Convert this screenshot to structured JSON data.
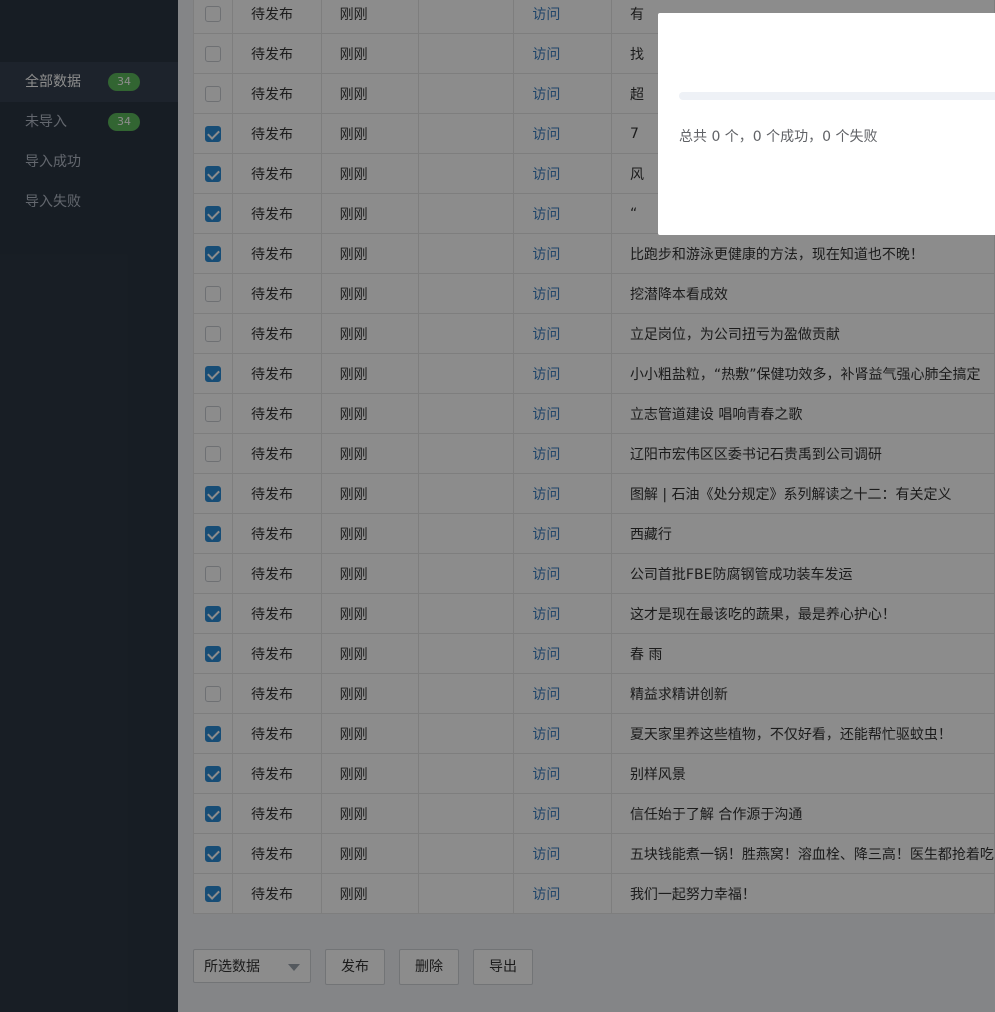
{
  "sidebar": {
    "items": [
      {
        "label": "全部数据",
        "badge": "34",
        "active": true
      },
      {
        "label": "未导入",
        "badge": "34",
        "active": false
      },
      {
        "label": "导入成功",
        "badge": "",
        "active": false
      },
      {
        "label": "导入失败",
        "badge": "",
        "active": false
      }
    ]
  },
  "table": {
    "rows": [
      {
        "checked": false,
        "status": "待发布",
        "time": "刚刚",
        "link": "访问",
        "title": "有"
      },
      {
        "checked": false,
        "status": "待发布",
        "time": "刚刚",
        "link": "访问",
        "title": "找"
      },
      {
        "checked": false,
        "status": "待发布",
        "time": "刚刚",
        "link": "访问",
        "title": "超"
      },
      {
        "checked": true,
        "status": "待发布",
        "time": "刚刚",
        "link": "访问",
        "title": "7"
      },
      {
        "checked": true,
        "status": "待发布",
        "time": "刚刚",
        "link": "访问",
        "title": "风"
      },
      {
        "checked": true,
        "status": "待发布",
        "time": "刚刚",
        "link": "访问",
        "title": "“"
      },
      {
        "checked": true,
        "status": "待发布",
        "time": "刚刚",
        "link": "访问",
        "title": "比跑步和游泳更健康的方法，现在知道也不晚！"
      },
      {
        "checked": false,
        "status": "待发布",
        "time": "刚刚",
        "link": "访问",
        "title": "挖潜降本看成效"
      },
      {
        "checked": false,
        "status": "待发布",
        "time": "刚刚",
        "link": "访问",
        "title": "立足岗位，为公司扭亏为盈做贡献"
      },
      {
        "checked": true,
        "status": "待发布",
        "time": "刚刚",
        "link": "访问",
        "title": "小小粗盐粒，“热敷”保健功效多，补肾益气强心肺全搞定"
      },
      {
        "checked": false,
        "status": "待发布",
        "time": "刚刚",
        "link": "访问",
        "title": "立志管道建设 唱响青春之歌"
      },
      {
        "checked": false,
        "status": "待发布",
        "time": "刚刚",
        "link": "访问",
        "title": "辽阳市宏伟区区委书记石贵禹到公司调研"
      },
      {
        "checked": true,
        "status": "待发布",
        "time": "刚刚",
        "link": "访问",
        "title": "图解 | 石油《处分规定》系列解读之十二：有关定义"
      },
      {
        "checked": true,
        "status": "待发布",
        "time": "刚刚",
        "link": "访问",
        "title": "西藏行"
      },
      {
        "checked": false,
        "status": "待发布",
        "time": "刚刚",
        "link": "访问",
        "title": "公司首批FBE防腐钢管成功装车发运"
      },
      {
        "checked": true,
        "status": "待发布",
        "time": "刚刚",
        "link": "访问",
        "title": "这才是现在最该吃的蔬果，最是养心护心！"
      },
      {
        "checked": true,
        "status": "待发布",
        "time": "刚刚",
        "link": "访问",
        "title": "春 雨"
      },
      {
        "checked": false,
        "status": "待发布",
        "time": "刚刚",
        "link": "访问",
        "title": "精益求精讲创新"
      },
      {
        "checked": true,
        "status": "待发布",
        "time": "刚刚",
        "link": "访问",
        "title": "夏天家里养这些植物，不仅好看，还能帮忙驱蚊虫！"
      },
      {
        "checked": true,
        "status": "待发布",
        "time": "刚刚",
        "link": "访问",
        "title": "别样风景"
      },
      {
        "checked": true,
        "status": "待发布",
        "time": "刚刚",
        "link": "访问",
        "title": "信任始于了解 合作源于沟通"
      },
      {
        "checked": true,
        "status": "待发布",
        "time": "刚刚",
        "link": "访问",
        "title": "五块钱能煮一锅！胜燕窝！溶血栓、降三高！医生都抢着吃"
      },
      {
        "checked": true,
        "status": "待发布",
        "time": "刚刚",
        "link": "访问",
        "title": "我们一起努力幸福！"
      }
    ]
  },
  "toolbar": {
    "select_value": "所选数据",
    "publish_label": "发布",
    "delete_label": "删除",
    "export_label": "导出"
  },
  "modal": {
    "summary": "总共 0 个，0 个成功，0 个失败",
    "progress_fraction": 0
  }
}
